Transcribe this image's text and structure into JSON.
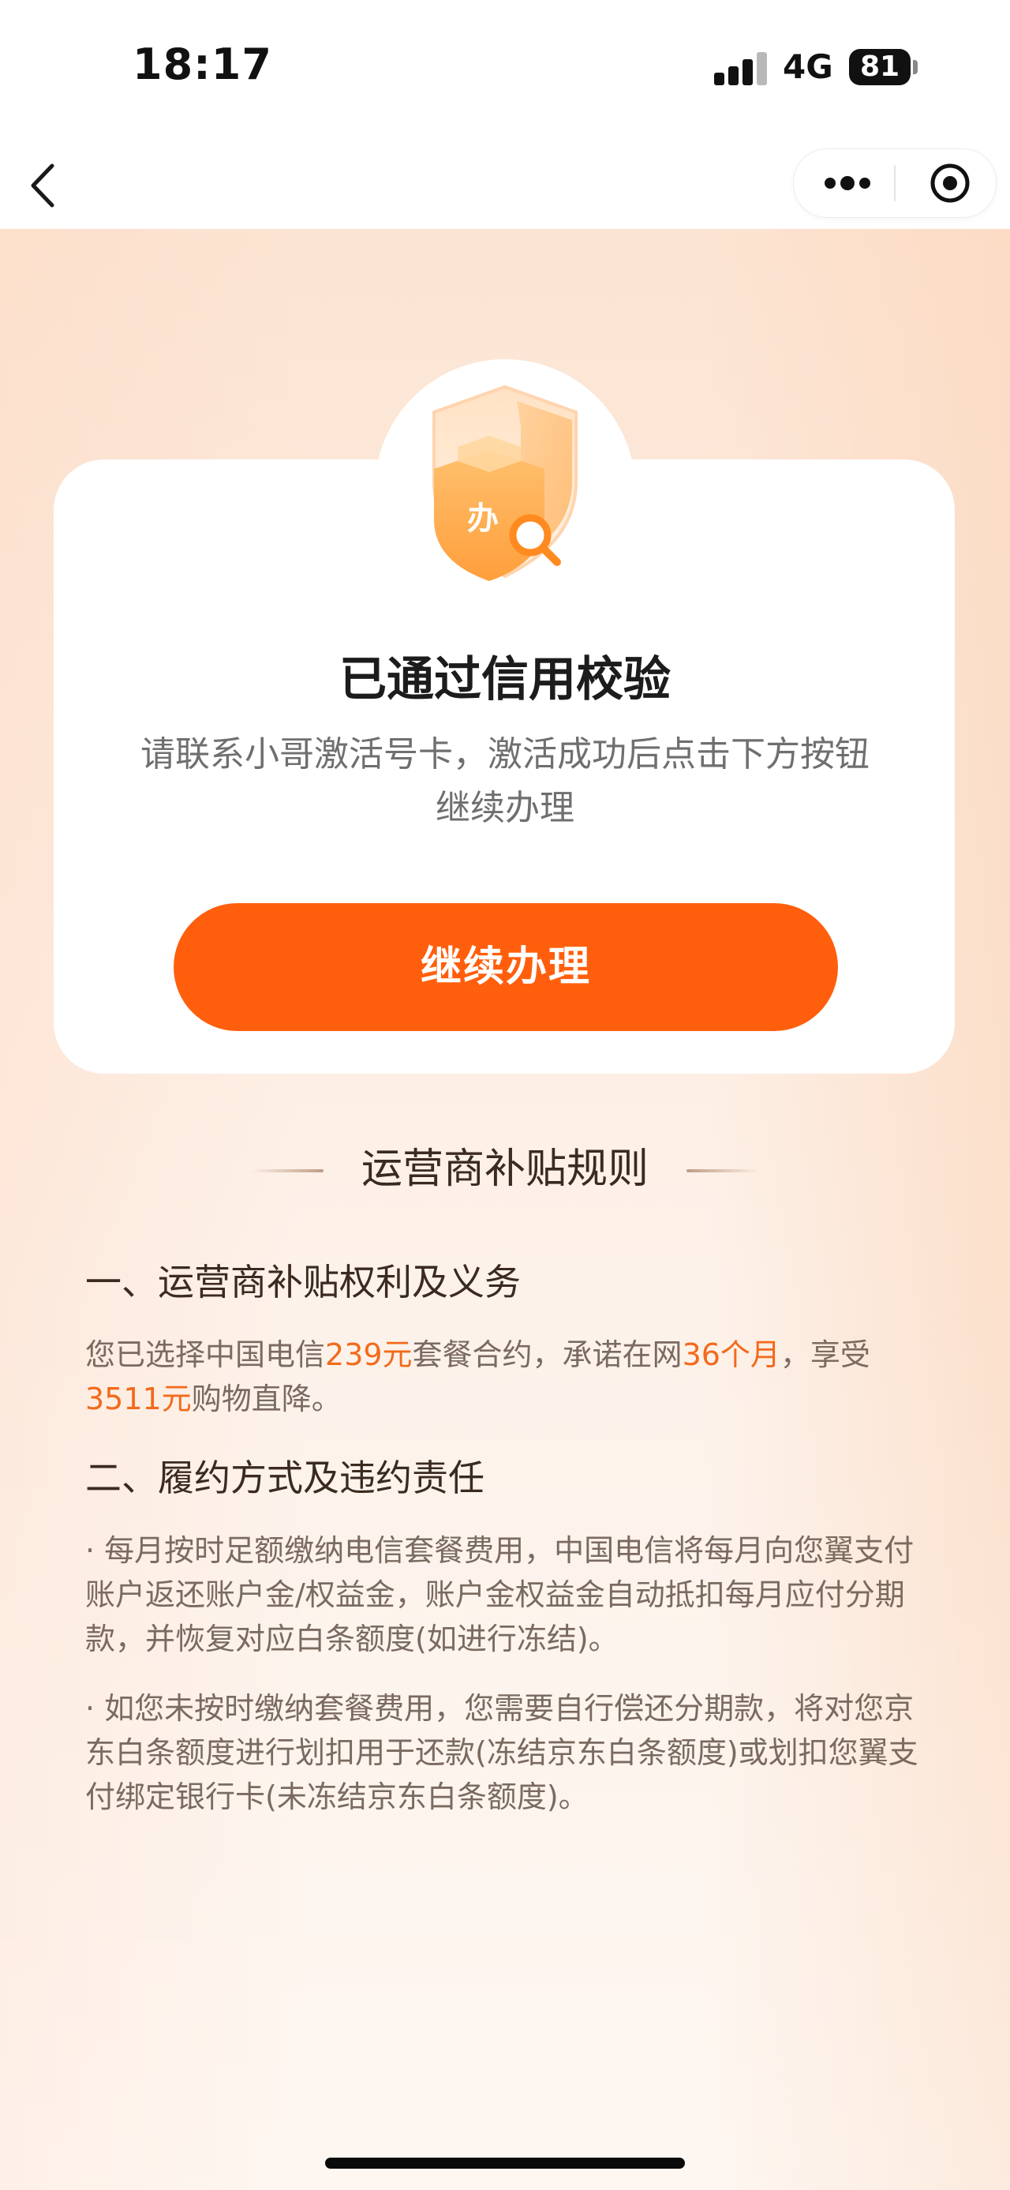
{
  "status_bar": {
    "time": "18:17",
    "network": "4G",
    "battery": "81"
  },
  "nav": {
    "back_icon": "chevron-left-icon",
    "more_icon": "more-dots-icon",
    "close_icon": "target-close-icon"
  },
  "card": {
    "badge_icon": "shield-search-icon",
    "badge_text": "办",
    "title": "已通过信用校验",
    "description": "请联系小哥激活号卡，激活成功后点击下方按钮继续办理",
    "button_label": "继续办理"
  },
  "rules": {
    "title": "运营商补贴规则",
    "section1": {
      "heading": "一、运营商补贴权利及义务",
      "p_prefix": "您已选择中国电信",
      "p_price": "239元",
      "p_mid": "套餐合约，承诺在网",
      "p_months": "36个月",
      "p_mid2": "，享受",
      "p_discount": "3511元",
      "p_suffix": "购物直降。"
    },
    "section2": {
      "heading": "二、履约方式及违约责任",
      "bullet1": "· 每月按时足额缴纳电信套餐费用，中国电信将每月向您翼支付账户返还账户金/权益金，账户金权益金自动抵扣每月应付分期款，并恢复对应白条额度(如进行冻结)。",
      "bullet2": "· 如您未按时缴纳套餐费用，您需要自行偿还分期款，将对您京东白条额度进行划扣用于还款(冻结京东白条额度)或划扣您翼支付绑定银行卡(未冻结京东白条额度)。"
    }
  },
  "colors": {
    "accent": "#ff5f0d",
    "highlight": "#f26a1b"
  }
}
